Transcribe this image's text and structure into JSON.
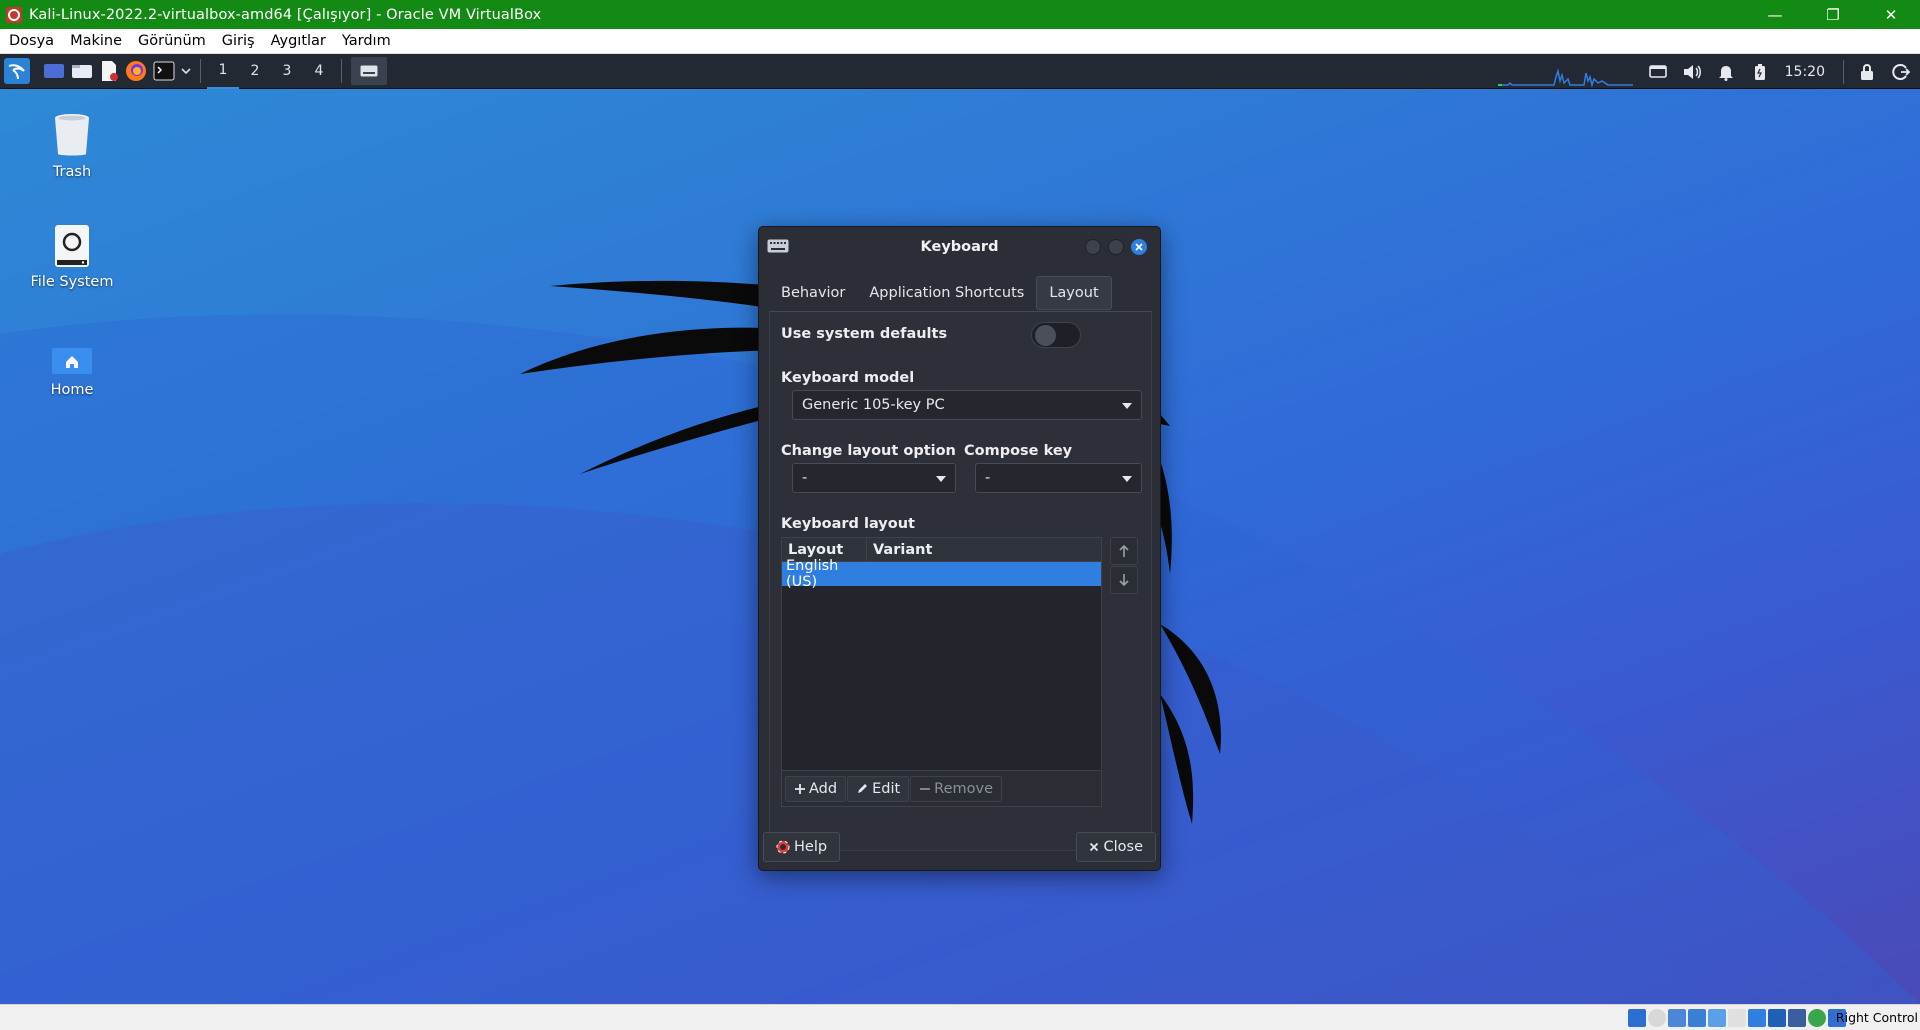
{
  "host_window": {
    "title": "Kali-Linux-2022.2-virtualbox-amd64 [Çalışıyor] - Oracle VM VirtualBox",
    "controls": {
      "minimize": "—",
      "restore": "❐",
      "close": "✕"
    }
  },
  "host_menu": [
    "Dosya",
    "Makine",
    "Görünüm",
    "Giriş",
    "Aygıtlar",
    "Yardım"
  ],
  "panel": {
    "workspaces": [
      "1",
      "2",
      "3",
      "4"
    ],
    "active_workspace": "1",
    "clock": "15:20"
  },
  "desktop_icons": [
    {
      "label": "Trash",
      "icon": "trash-icon"
    },
    {
      "label": "File System",
      "icon": "drive-icon"
    },
    {
      "label": "Home",
      "icon": "home-folder-icon"
    }
  ],
  "dialog": {
    "title": "Keyboard",
    "tabs": [
      {
        "label": "Behavior",
        "active": false
      },
      {
        "label": "Application Shortcuts",
        "active": false
      },
      {
        "label": "Layout",
        "active": true
      }
    ],
    "use_system_defaults_label": "Use system defaults",
    "use_system_defaults_on": false,
    "keyboard_model_label": "Keyboard model",
    "keyboard_model_value": "Generic 105-key PC",
    "change_layout_label": "Change layout option",
    "change_layout_value": "-",
    "compose_key_label": "Compose key",
    "compose_key_value": "-",
    "keyboard_layout_label": "Keyboard layout",
    "columns": [
      "Layout",
      "Variant"
    ],
    "rows": [
      {
        "layout": "English (US)",
        "variant": "",
        "selected": true
      }
    ],
    "add_label": "Add",
    "edit_label": "Edit",
    "remove_label": "Remove",
    "help_label": "Help",
    "close_label": "Close"
  },
  "status_bar": {
    "host_key": "Right Control"
  },
  "colors": {
    "host_titlebar": "#128a14",
    "panel": "#222933",
    "accent": "#2f7ee0",
    "dialog_bg": "#2b2e36"
  }
}
